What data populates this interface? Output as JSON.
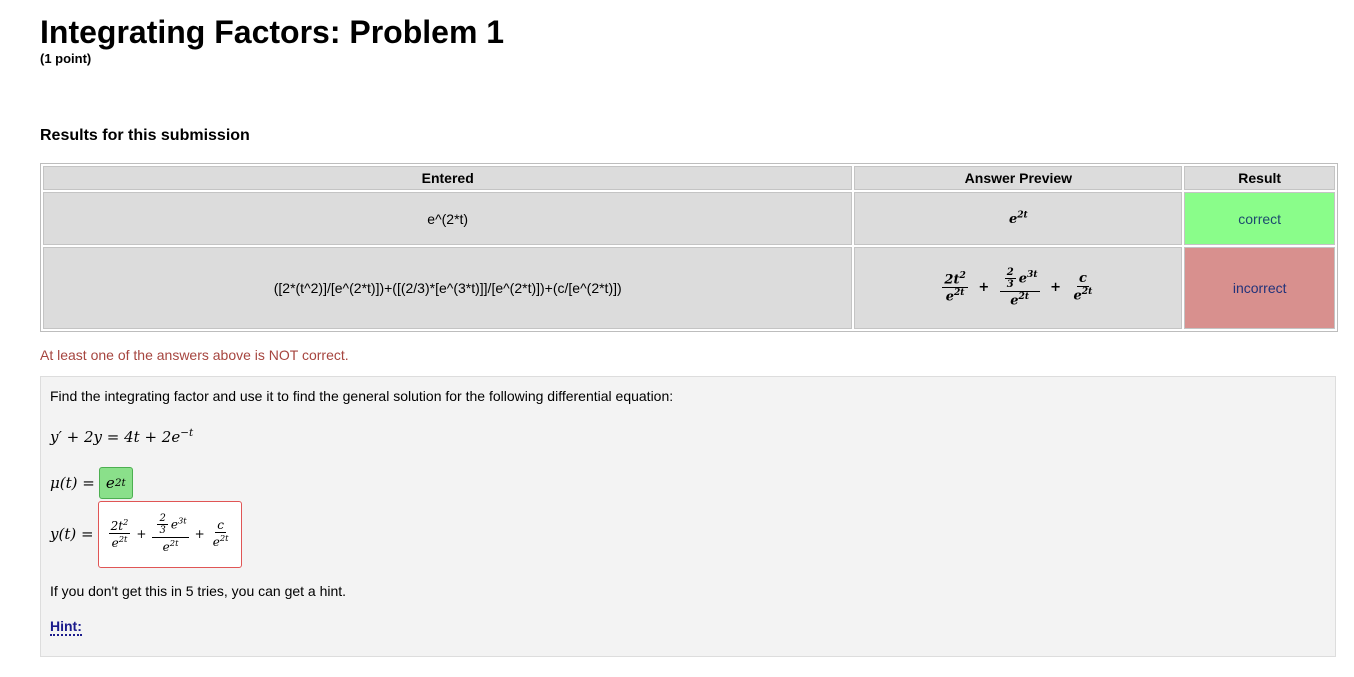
{
  "header": {
    "title": "Integrating Factors: Problem 1",
    "points": "(1 point)"
  },
  "results": {
    "heading": "Results for this submission",
    "columns": [
      "Entered",
      "Answer Preview",
      "Result"
    ],
    "rows": [
      {
        "entered": "e^(2*t)",
        "preview": "e^{2t}",
        "result": "correct"
      },
      {
        "entered": "([2*(t^2)]/[e^(2*t)])+([(2/3)*[e^(3*t)]]/[e^(2*t)])+(c/[e^(2*t)])",
        "preview": "2t^2/e^{2t} + (2/3)e^{3t}/e^{2t} + c/e^{2t}",
        "result": "incorrect"
      }
    ],
    "warning": "At least one of the answers above is NOT correct."
  },
  "problem": {
    "prompt": "Find the integrating factor and use it to find the general solution for the following differential equation:",
    "equation": "y′ + 2y = 4t + 2e",
    "equation_exp": "−t",
    "mu_label": "μ(t) =",
    "mu_answer": "e^{2t}",
    "y_label": "y(t) =",
    "y_answer": "2t^2/e^{2t} + (2/3)e^{3t}/e^{2t} + c/e^{2t}",
    "hint_text": "If you don't get this in 5 tries, you can get a hint.",
    "hint_link": "Hint:"
  },
  "colors": {
    "correct_bg": "#8afd8a",
    "incorrect_bg": "#d8908e",
    "warning_text": "#a6453f",
    "link": "#1a1a8c"
  }
}
